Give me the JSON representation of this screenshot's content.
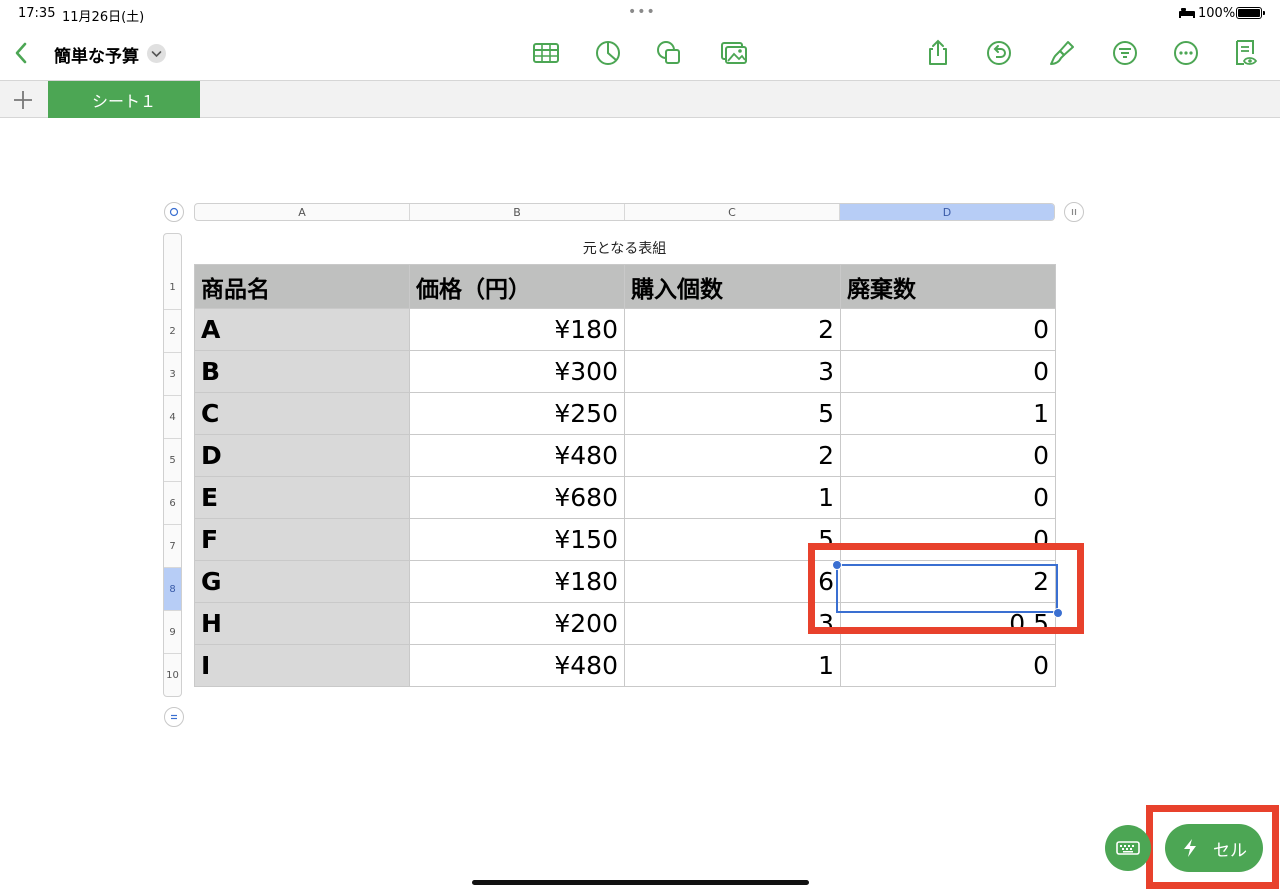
{
  "status_bar": {
    "time": "17:35",
    "date": "11月26日(土)",
    "battery_percent": "100%"
  },
  "toolbar": {
    "document_title": "簡単な予算",
    "icons": [
      "table-icon",
      "chart-icon",
      "shape-icon",
      "media-icon",
      "share-icon",
      "undo-icon",
      "format-brush-icon",
      "filter-icon",
      "more-icon",
      "reader-view-icon"
    ]
  },
  "tabs": {
    "add_label": "+",
    "sheets": [
      {
        "label": "シート１",
        "active": true
      }
    ]
  },
  "table": {
    "title": "元となる表組",
    "columns": [
      "A",
      "B",
      "C",
      "D"
    ],
    "selected_column": "D",
    "rows": [
      "1",
      "2",
      "3",
      "4",
      "5",
      "6",
      "7",
      "8",
      "9",
      "10"
    ],
    "selected_row": "8",
    "header": [
      "商品名",
      "価格（円）",
      "購入個数",
      "廃棄数"
    ],
    "data": [
      [
        "A",
        "¥180",
        "2",
        "0"
      ],
      [
        "B",
        "¥300",
        "3",
        "0"
      ],
      [
        "C",
        "¥250",
        "5",
        "1"
      ],
      [
        "D",
        "¥480",
        "2",
        "0"
      ],
      [
        "E",
        "¥680",
        "1",
        "0"
      ],
      [
        "F",
        "¥150",
        "5",
        "0"
      ],
      [
        "G",
        "¥180",
        "6",
        "2"
      ],
      [
        "H",
        "¥200",
        "3",
        "0.5"
      ],
      [
        "I",
        "¥480",
        "1",
        "0"
      ]
    ]
  },
  "bottom": {
    "cell_button_label": "セル"
  },
  "colors": {
    "accent": "#4ca654",
    "selection": "#3a6fd1",
    "highlight": "#e8412c"
  }
}
